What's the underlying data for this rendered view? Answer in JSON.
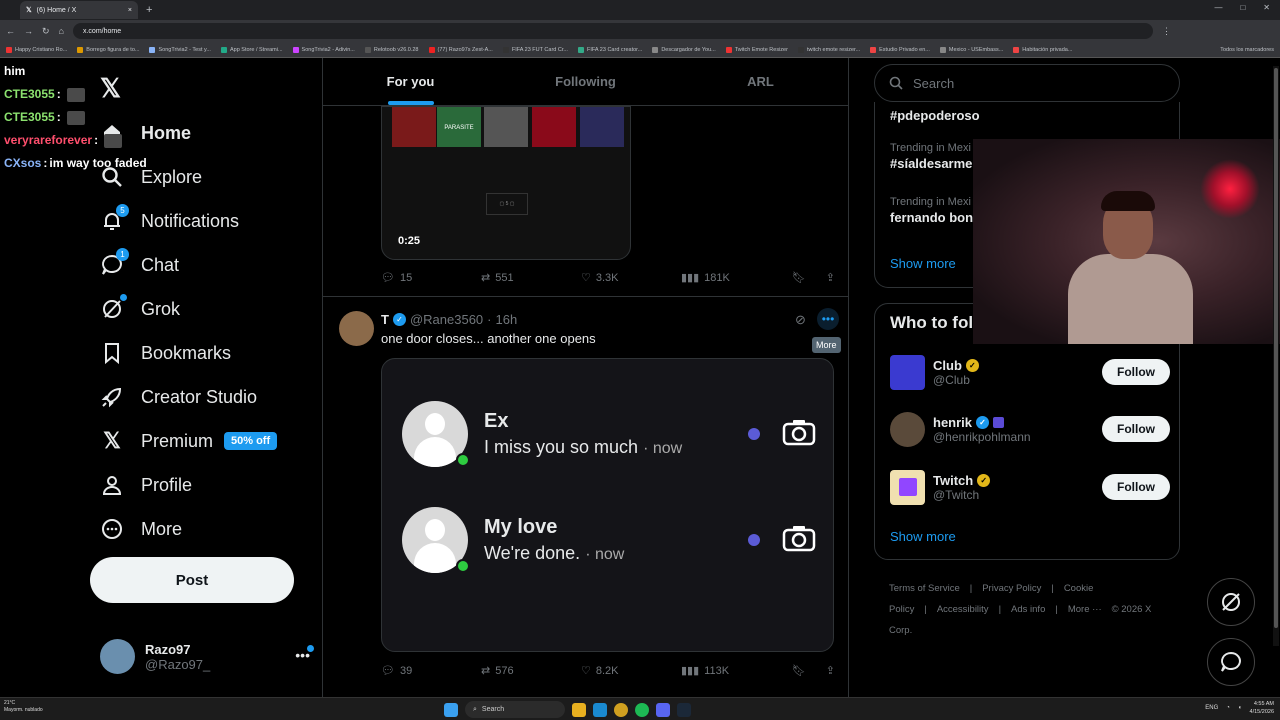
{
  "browser": {
    "tab_title": "(6) Home / X",
    "url": "x.com/home",
    "close": "×",
    "new_tab": "+",
    "bookmarks": [
      "Happy Cristiano Ro...",
      "Borrego figura de to...",
      "SongTrivia2 - Test y...",
      "App Store / Streami...",
      "SongTrivia2 - Adivin...",
      "Relotoob v26.0.28",
      "(77) Razo97s Zest-A...",
      "FIFA 23 FUT Card Cr...",
      "FIFA 23 Card creator...",
      "Descargador de You...",
      "Twitch Emote Resizer",
      "twitch emote resizer...",
      "Estudio Privado en...",
      "Mexico - USEmbass...",
      "Habitación privada..."
    ],
    "all_bookmarks": "Todos los marcadores"
  },
  "chat": [
    {
      "user": "him",
      "text": "",
      "color": "#ffffff"
    },
    {
      "user": "CTE3055",
      "text": "",
      "color": "#8ce26f"
    },
    {
      "user": "CTE3055",
      "text": "",
      "color": "#8ce26f"
    },
    {
      "user": "veryrareforever",
      "text": "",
      "color": "#ff4f6d"
    },
    {
      "user": "CXsos",
      "text": "im way too faded",
      "color": "#8ab4f8"
    }
  ],
  "nav": {
    "home": "Home",
    "explore": "Explore",
    "notifications": "Notifications",
    "notifications_badge": "5",
    "chat": "Chat",
    "chat_badge": "1",
    "grok": "Grok",
    "bookmarks": "Bookmarks",
    "creator_studio": "Creator Studio",
    "premium": "Premium",
    "premium_badge": "50% off",
    "profile": "Profile",
    "more": "More",
    "post": "Post"
  },
  "account": {
    "name": "Razo97",
    "handle": "@Razo97_"
  },
  "tabs": {
    "for_you": "For you",
    "following": "Following",
    "arl": "ARL"
  },
  "tweet1": {
    "video_time": "0:25",
    "replies": "15",
    "reposts": "551",
    "likes": "3.3K",
    "views": "181K",
    "poster_text": "PARASITE"
  },
  "tweet2": {
    "name": "T",
    "handle": "@Rane3560",
    "time": "16h",
    "text": "one door closes... another one opens",
    "tooltip": "More",
    "replies": "39",
    "reposts": "576",
    "likes": "8.2K",
    "views": "113K",
    "notifs": [
      {
        "who": "Ex",
        "msg": "I miss you so much",
        "time": "· now"
      },
      {
        "who": "My love",
        "msg": "We're done.",
        "time": "· now"
      }
    ]
  },
  "sidebar": {
    "search_placeholder": "Search",
    "trends": [
      {
        "cat": "",
        "name": "#pdepoderoso"
      },
      {
        "cat": "Trending in Mexi",
        "name": "#síaldesarme"
      },
      {
        "cat": "Trending in Mexi",
        "name": "fernando bon"
      }
    ],
    "show_more": "Show more",
    "who_title": "Who to fol",
    "accounts": [
      {
        "name": "Club",
        "handle": "@Club",
        "color": "#3a3ad0"
      },
      {
        "name": "henrik",
        "handle": "@henrikpohlmann",
        "color": "#5a4a3a"
      },
      {
        "name": "Twitch",
        "handle": "@Twitch",
        "color": "#f0e0b0"
      }
    ],
    "follow": "Follow",
    "show_more2": "Show more",
    "footer": [
      "Terms of Service",
      "|",
      "Privacy Policy",
      "|",
      "Cookie Policy",
      "|",
      "Accessibility",
      "|",
      "Ads info",
      "|",
      "More ···",
      "© 2026 X Corp."
    ]
  },
  "taskbar": {
    "weather_temp": "21°C",
    "weather_desc": "Mayorm. nublado",
    "search": "Search",
    "lang": "ENG",
    "time": "4:55 AM",
    "date": "4/15/2026"
  }
}
